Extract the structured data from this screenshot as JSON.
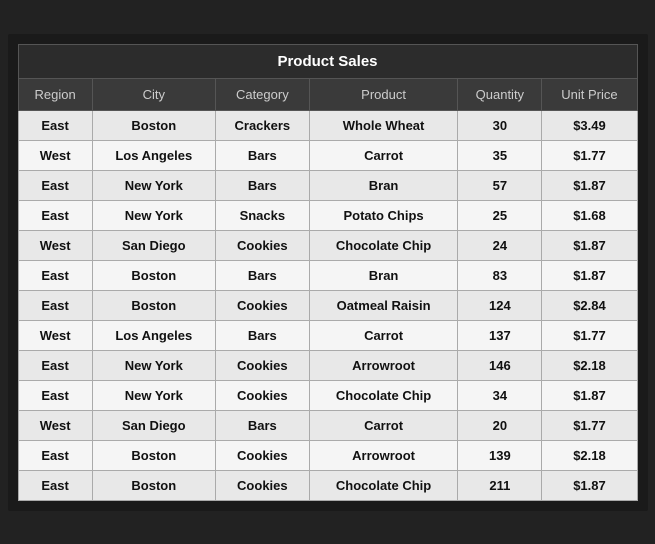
{
  "title": "Product Sales",
  "columns": [
    "Region",
    "City",
    "Category",
    "Product",
    "Quantity",
    "Unit Price"
  ],
  "rows": [
    [
      "East",
      "Boston",
      "Crackers",
      "Whole Wheat",
      "30",
      "$3.49"
    ],
    [
      "West",
      "Los Angeles",
      "Bars",
      "Carrot",
      "35",
      "$1.77"
    ],
    [
      "East",
      "New York",
      "Bars",
      "Bran",
      "57",
      "$1.87"
    ],
    [
      "East",
      "New York",
      "Snacks",
      "Potato Chips",
      "25",
      "$1.68"
    ],
    [
      "West",
      "San Diego",
      "Cookies",
      "Chocolate Chip",
      "24",
      "$1.87"
    ],
    [
      "East",
      "Boston",
      "Bars",
      "Bran",
      "83",
      "$1.87"
    ],
    [
      "East",
      "Boston",
      "Cookies",
      "Oatmeal Raisin",
      "124",
      "$2.84"
    ],
    [
      "West",
      "Los Angeles",
      "Bars",
      "Carrot",
      "137",
      "$1.77"
    ],
    [
      "East",
      "New York",
      "Cookies",
      "Arrowroot",
      "146",
      "$2.18"
    ],
    [
      "East",
      "New York",
      "Cookies",
      "Chocolate Chip",
      "34",
      "$1.87"
    ],
    [
      "West",
      "San Diego",
      "Bars",
      "Carrot",
      "20",
      "$1.77"
    ],
    [
      "East",
      "Boston",
      "Cookies",
      "Arrowroot",
      "139",
      "$2.18"
    ],
    [
      "East",
      "Boston",
      "Cookies",
      "Chocolate Chip",
      "211",
      "$1.87"
    ]
  ]
}
